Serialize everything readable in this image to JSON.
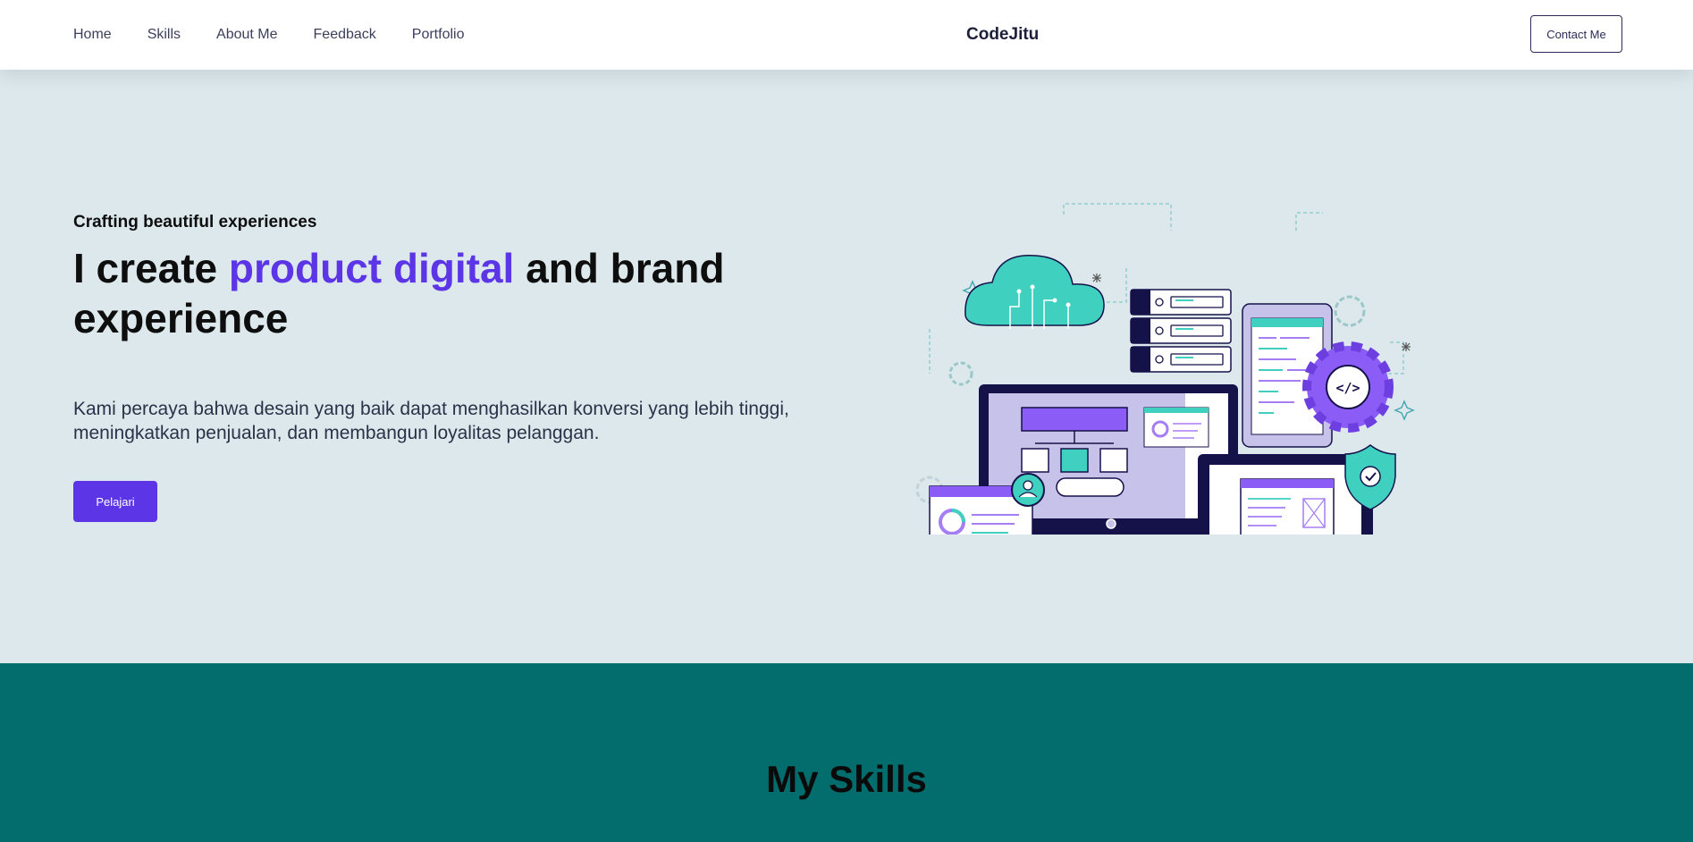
{
  "nav": {
    "links": [
      "Home",
      "Skills",
      "About Me",
      "Feedback",
      "Portfolio"
    ],
    "brand": "CodeJitu",
    "contact_label": "Contact Me"
  },
  "hero": {
    "eyebrow": "Crafting beautiful experiences",
    "headline_start": "I create ",
    "headline_accent": "product digital",
    "headline_end": " and brand experience",
    "description": "Kami percaya bahwa desain yang baik dapat menghasilkan konversi yang lebih tinggi, meningkatkan penjualan, dan membangun loyalitas pelanggan.",
    "cta_label": "Pelajari",
    "illustration_code_label": "</>"
  },
  "skills": {
    "title": "My Skills"
  },
  "colors": {
    "accent": "#5b35e6",
    "hero_bg": "#dce8ec",
    "skills_bg": "#026d6c",
    "teal": "#3fd0c0",
    "navy": "#15124a"
  }
}
